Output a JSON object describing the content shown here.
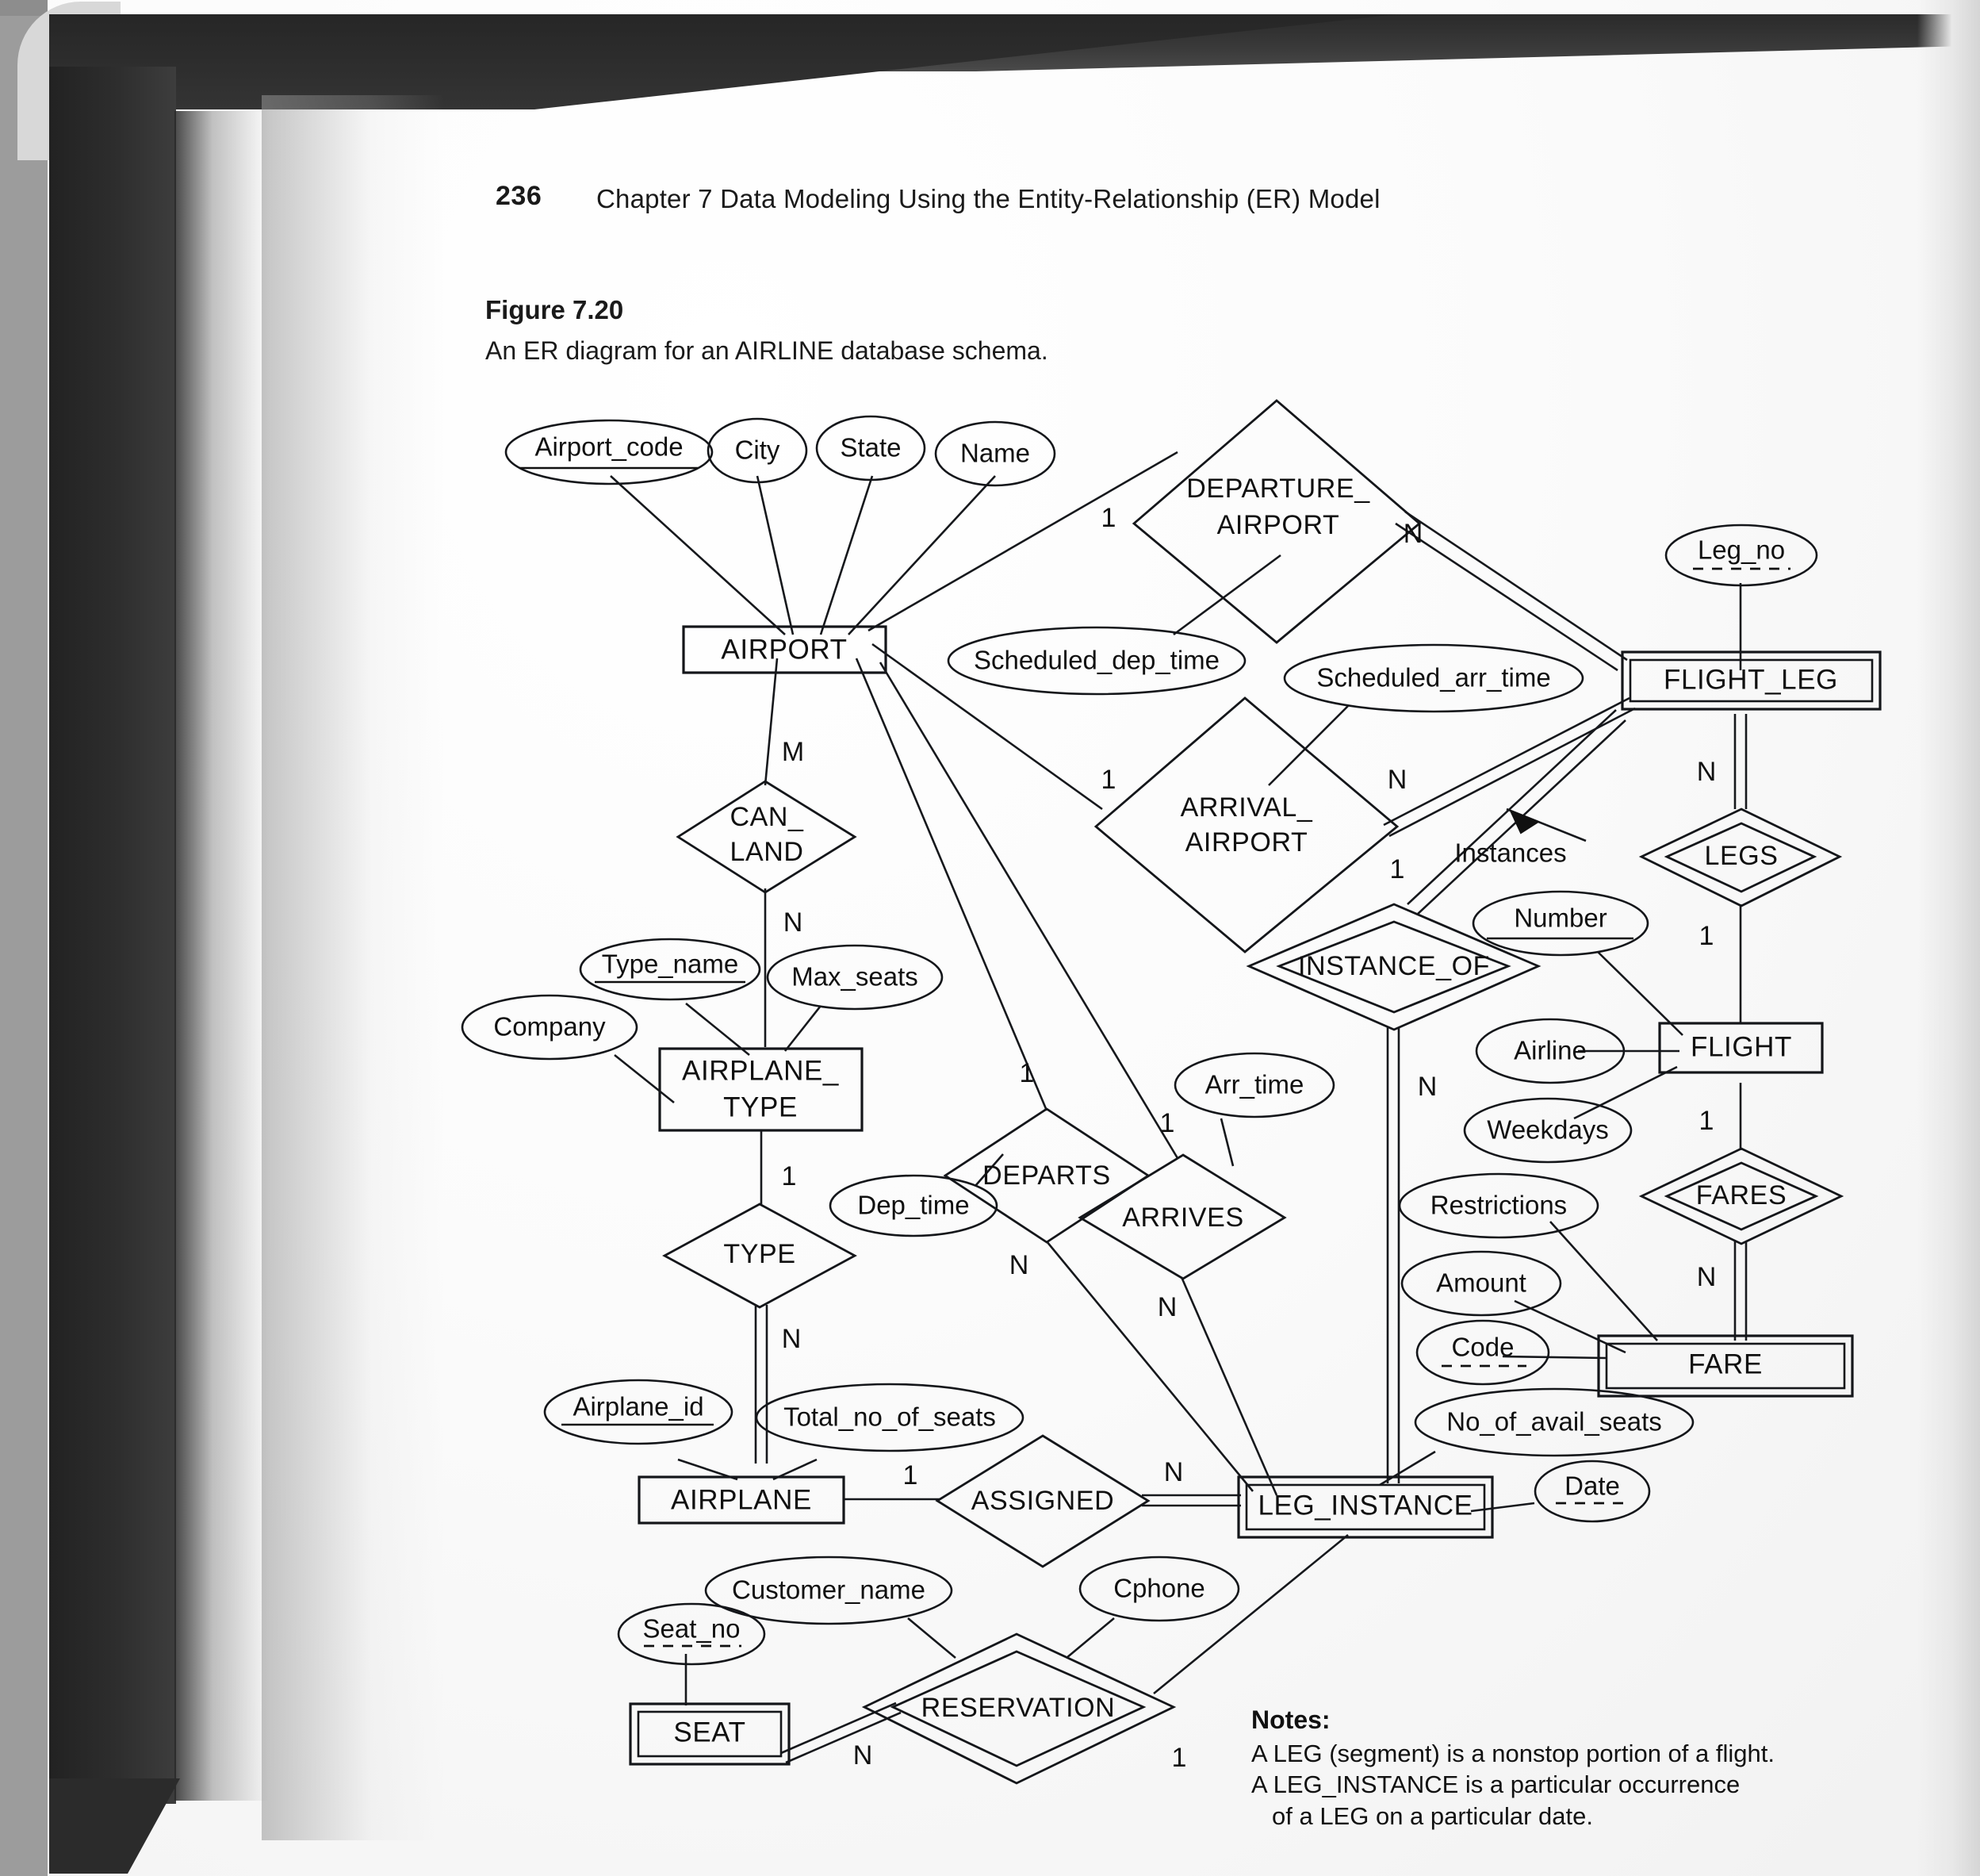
{
  "page": {
    "page_number": "236",
    "chapter_title": "Chapter 7  Data Modeling Using the Entity-Relationship (ER) Model",
    "figure_label": "Figure 7.20",
    "figure_caption": "An ER diagram for an AIRLINE database schema."
  },
  "notes": {
    "title": "Notes:",
    "line1": "A LEG (segment) is a nonstop portion of a flight.",
    "line2": "A LEG_INSTANCE is a particular occurrence",
    "line3": "of a LEG on a particular date."
  },
  "colors": {
    "ink": "#101010",
    "paper": "#f7f7f7",
    "scan_dark": "#2b2b2b"
  },
  "chart_data": {
    "type": "diagram",
    "diagram_kind": "entity-relationship",
    "title": "An ER diagram for an AIRLINE database schema.",
    "entities": [
      {
        "name": "AIRPORT",
        "weak": false,
        "attributes": [
          {
            "name": "Airport_code",
            "key": "primary"
          },
          {
            "name": "City",
            "key": "none"
          },
          {
            "name": "State",
            "key": "none"
          },
          {
            "name": "Name",
            "key": "none"
          }
        ]
      },
      {
        "name": "AIRPLANE_TYPE",
        "weak": false,
        "attributes": [
          {
            "name": "Type_name",
            "key": "primary"
          },
          {
            "name": "Max_seats",
            "key": "none"
          },
          {
            "name": "Company",
            "key": "none"
          }
        ]
      },
      {
        "name": "AIRPLANE",
        "weak": false,
        "attributes": [
          {
            "name": "Airplane_id",
            "key": "primary"
          },
          {
            "name": "Total_no_of_seats",
            "key": "none"
          }
        ]
      },
      {
        "name": "FLIGHT",
        "weak": false,
        "attributes": [
          {
            "name": "Number",
            "key": "primary"
          },
          {
            "name": "Airline",
            "key": "none"
          },
          {
            "name": "Weekdays",
            "key": "none"
          }
        ]
      },
      {
        "name": "FLIGHT_LEG",
        "weak": true,
        "attributes": [
          {
            "name": "Leg_no",
            "key": "partial"
          },
          {
            "name": "Scheduled_dep_time",
            "key": "none"
          },
          {
            "name": "Scheduled_arr_time",
            "key": "none"
          }
        ]
      },
      {
        "name": "LEG_INSTANCE",
        "weak": true,
        "attributes": [
          {
            "name": "Date",
            "key": "partial"
          },
          {
            "name": "No_of_avail_seats",
            "key": "none"
          },
          {
            "name": "Dep_time",
            "key": "none"
          },
          {
            "name": "Arr_time",
            "key": "none"
          }
        ]
      },
      {
        "name": "FARE",
        "weak": true,
        "attributes": [
          {
            "name": "Code",
            "key": "partial"
          },
          {
            "name": "Amount",
            "key": "none"
          },
          {
            "name": "Restrictions",
            "key": "none"
          }
        ]
      },
      {
        "name": "SEAT",
        "weak": true,
        "attributes": [
          {
            "name": "Seat_no",
            "key": "partial"
          }
        ]
      }
    ],
    "relationships": [
      {
        "name": "DEPARTURE_AIRPORT",
        "identifying": false,
        "participants": [
          {
            "entity": "AIRPORT",
            "cardinality": "1"
          },
          {
            "entity": "FLIGHT_LEG",
            "cardinality": "N"
          }
        ]
      },
      {
        "name": "ARRIVAL_AIRPORT",
        "identifying": false,
        "participants": [
          {
            "entity": "AIRPORT",
            "cardinality": "1"
          },
          {
            "entity": "FLIGHT_LEG",
            "cardinality": "N"
          }
        ]
      },
      {
        "name": "CAN_LAND",
        "identifying": false,
        "participants": [
          {
            "entity": "AIRPORT",
            "cardinality": "M"
          },
          {
            "entity": "AIRPLANE_TYPE",
            "cardinality": "N"
          }
        ]
      },
      {
        "name": "TYPE",
        "identifying": false,
        "participants": [
          {
            "entity": "AIRPLANE_TYPE",
            "cardinality": "1"
          },
          {
            "entity": "AIRPLANE",
            "cardinality": "N"
          }
        ]
      },
      {
        "name": "LEGS",
        "identifying": true,
        "participants": [
          {
            "entity": "FLIGHT_LEG",
            "cardinality": "N"
          },
          {
            "entity": "FLIGHT",
            "cardinality": "1"
          }
        ]
      },
      {
        "name": "FARES",
        "identifying": true,
        "participants": [
          {
            "entity": "FLIGHT",
            "cardinality": "1"
          },
          {
            "entity": "FARE",
            "cardinality": "N"
          }
        ]
      },
      {
        "name": "INSTANCE_OF",
        "identifying": true,
        "participants": [
          {
            "entity": "FLIGHT_LEG",
            "cardinality": "1"
          },
          {
            "entity": "LEG_INSTANCE",
            "cardinality": "N"
          }
        ]
      },
      {
        "name": "DEPARTS",
        "identifying": false,
        "participants": [
          {
            "entity": "AIRPORT",
            "cardinality": "1"
          },
          {
            "entity": "LEG_INSTANCE",
            "cardinality": "N"
          }
        ]
      },
      {
        "name": "ARRIVES",
        "identifying": false,
        "participants": [
          {
            "entity": "AIRPORT",
            "cardinality": "1"
          },
          {
            "entity": "LEG_INSTANCE",
            "cardinality": "N"
          }
        ]
      },
      {
        "name": "ASSIGNED",
        "identifying": false,
        "participants": [
          {
            "entity": "AIRPLANE",
            "cardinality": "1"
          },
          {
            "entity": "LEG_INSTANCE",
            "cardinality": "N"
          }
        ]
      },
      {
        "name": "RESERVATION",
        "identifying": true,
        "participants": [
          {
            "entity": "SEAT",
            "cardinality": "N"
          },
          {
            "entity": "LEG_INSTANCE",
            "cardinality": "1"
          }
        ],
        "attributes": [
          {
            "name": "Customer_name"
          },
          {
            "name": "Cphone"
          }
        ]
      }
    ],
    "annotations": [
      {
        "text": "Instances",
        "points_to": "FLIGHT_LEG"
      }
    ]
  },
  "nodes": {
    "airport": "AIRPORT",
    "airplane_type_l1": "AIRPLANE_",
    "airplane_type_l2": "TYPE",
    "airplane": "AIRPLANE",
    "flight": "FLIGHT",
    "flight_leg": "FLIGHT_LEG",
    "leg_instance": "LEG_INSTANCE",
    "fare": "FARE",
    "seat": "SEAT",
    "departure_airport_l1": "DEPARTURE_",
    "departure_airport_l2": "AIRPORT",
    "arrival_airport_l1": "ARRIVAL_",
    "arrival_airport_l2": "AIRPORT",
    "can_land_l1": "CAN_",
    "can_land_l2": "LAND",
    "type_rel": "TYPE",
    "legs": "LEGS",
    "fares": "FARES",
    "instance_of": "INSTANCE_OF",
    "departs": "DEPARTS",
    "arrives": "ARRIVES",
    "assigned": "ASSIGNED",
    "reservation": "RESERVATION",
    "instances_label": "Instances"
  },
  "attributes": {
    "airport_code": "Airport_code",
    "city": "City",
    "state": "State",
    "name": "Name",
    "scheduled_dep_time": "Scheduled_dep_time",
    "scheduled_arr_time": "Scheduled_arr_time",
    "leg_no": "Leg_no",
    "number": "Number",
    "airline": "Airline",
    "weekdays": "Weekdays",
    "restrictions": "Restrictions",
    "amount": "Amount",
    "code": "Code",
    "type_name": "Type_name",
    "max_seats": "Max_seats",
    "company": "Company",
    "airplane_id": "Airplane_id",
    "total_no_of_seats": "Total_no_of_seats",
    "dep_time": "Dep_time",
    "arr_time": "Arr_time",
    "no_of_avail_seats": "No_of_avail_seats",
    "date": "Date",
    "customer_name": "Customer_name",
    "cphone": "Cphone",
    "seat_no": "Seat_no"
  },
  "cardinalities": {
    "dep_airport_1": "1",
    "dep_airport_N": "N",
    "arr_airport_1": "1",
    "arr_airport_N": "N",
    "can_land_M": "M",
    "can_land_N": "N",
    "type_1": "1",
    "type_N": "N",
    "legs_N": "N",
    "legs_1": "1",
    "fares_1": "1",
    "fares_N": "N",
    "instance_of_1": "1",
    "instance_of_N": "N",
    "departs_1": "1",
    "departs_N": "N",
    "arrives_1": "1",
    "arrives_N": "N",
    "assigned_1": "1",
    "assigned_N": "N",
    "reservation_N": "N",
    "reservation_1": "1"
  }
}
